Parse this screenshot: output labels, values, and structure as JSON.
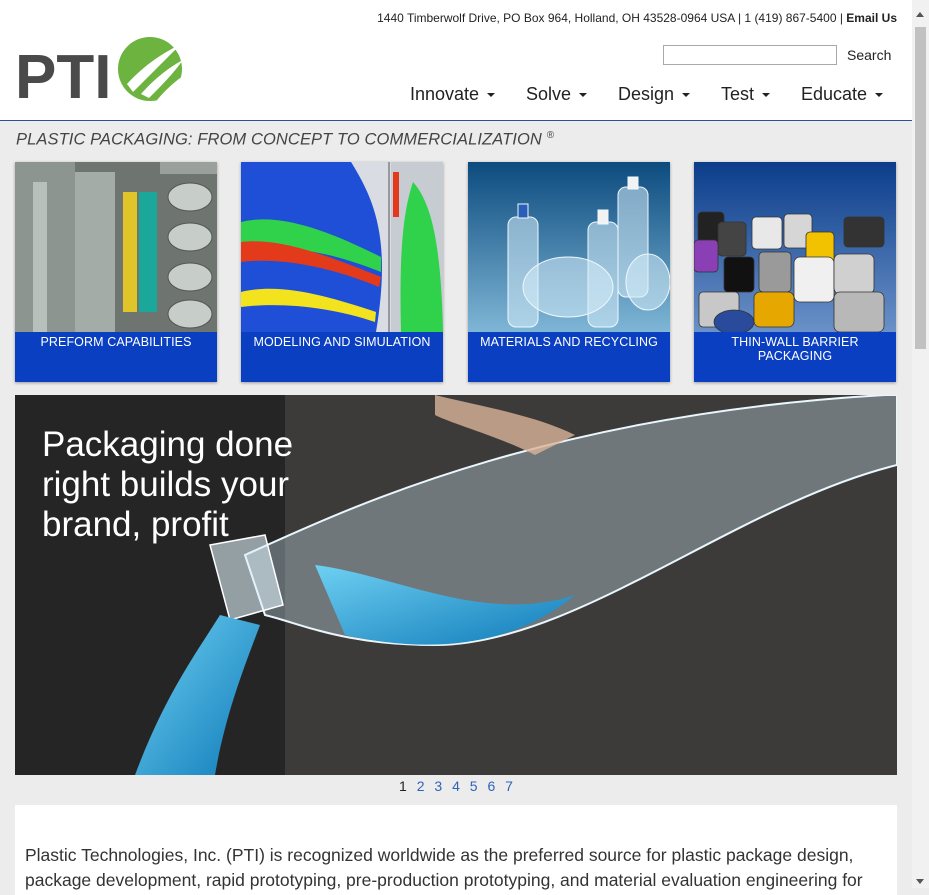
{
  "header": {
    "address": "1440 Timberwolf Drive, PO Box 964, Holland, OH 43528-0964 USA | 1 (419) 867-5400 | ",
    "email_label": "Email Us",
    "logo_text": "PTI",
    "search_button": "Search",
    "search_placeholder": ""
  },
  "nav": {
    "items": [
      {
        "label": "Innovate"
      },
      {
        "label": "Solve"
      },
      {
        "label": "Design"
      },
      {
        "label": "Test"
      },
      {
        "label": "Educate"
      }
    ]
  },
  "tagline": {
    "text": "PLASTIC PACKAGING: FROM CONCEPT TO COMMERCIALIZATION",
    "mark": "®"
  },
  "cards": [
    {
      "label": "PREFORM CAPABILITIES"
    },
    {
      "label": "MODELING AND SIMULATION"
    },
    {
      "label": "MATERIALS AND RECYCLING"
    },
    {
      "label": "THIN-WALL BARRIER PACKAGING"
    }
  ],
  "hero": {
    "text": "Packaging done right builds your brand, profit"
  },
  "pager": {
    "pages": [
      "1",
      "2",
      "3",
      "4",
      "5",
      "6",
      "7"
    ],
    "active": "1"
  },
  "content": {
    "paragraph": "Plastic Technologies, Inc. (PTI) is recognized worldwide as the preferred source for plastic package design, package development, rapid prototyping, pre-production prototyping, and material evaluation engineering for"
  },
  "colors": {
    "card_blue": "#0b3fc1",
    "logo_gray": "#4a4a4a",
    "logo_green": "#6cb33f",
    "link_blue": "#2f63b8",
    "header_rule": "#2b4f9e"
  }
}
